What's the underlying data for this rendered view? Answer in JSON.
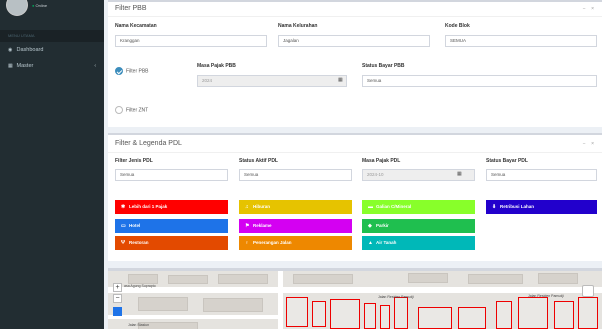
{
  "sidebar": {
    "user_status": "Online",
    "menu_header": "MENU UTAMA",
    "items": [
      {
        "label": "Dashboard",
        "icon": "dashboard-icon"
      },
      {
        "label": "Master",
        "icon": "th-icon"
      }
    ]
  },
  "filter_pbb": {
    "title": "Filter PBB",
    "tools": "− ×",
    "kecamatan_label": "Nama Kecamatan",
    "kecamatan_value": "Kranggan",
    "kelurahan_label": "Nama Kelurahan",
    "kelurahan_value": "Jagalan",
    "blok_label": "Kode Blok",
    "blok_value": "SEMUA",
    "radio_pbb_label": "Filter PBB",
    "masa_pajak_label": "Masa Pajak PBB",
    "masa_pajak_value": "2024",
    "status_bayar_label": "Status Bayar PBB",
    "status_bayar_value": "Semua",
    "radio_znt_label": "Filter ZNT"
  },
  "filter_pdl": {
    "title": "Filter & Legenda PDL",
    "tools": "− ×",
    "jenis_label": "Filter Jenis PDL",
    "jenis_value": "Semua",
    "status_aktif_label": "Status Aktif PDL",
    "status_aktif_value": "Semua",
    "masa_pajak_label": "Masa Pajak PDL",
    "masa_pajak_value": "2024-10",
    "status_bayar_label": "Status Bayar PDL",
    "status_bayar_value": "Semua"
  },
  "legend": [
    {
      "label": "Lebih dari 1 Pajak",
      "color": "#ff0000",
      "icon": "asterisk-icon"
    },
    {
      "label": "Hiburan",
      "color": "#e6c300",
      "icon": "music-icon"
    },
    {
      "label": "Galian C/Mineral",
      "color": "#88ff2a",
      "icon": "truck-icon"
    },
    {
      "label": "Retribusi Lahan",
      "color": "#2200cc",
      "icon": "pin-icon"
    },
    {
      "label": "Hotel",
      "color": "#1e73e8",
      "icon": "bed-icon"
    },
    {
      "label": "Reklame",
      "color": "#d400f2",
      "icon": "flag-icon"
    },
    {
      "label": "Parkir",
      "color": "#1fbf4f",
      "icon": "car-icon"
    },
    {
      "label": "Restoran",
      "color": "#e34a00",
      "icon": "utensils-icon"
    },
    {
      "label": "Penerangan Jalan",
      "color": "#ee8800",
      "icon": "bulb-icon"
    },
    {
      "label": "Air Tanah",
      "color": "#00b8b8",
      "icon": "water-icon"
    }
  ],
  "map": {
    "zoom_in": "+",
    "zoom_out": "−",
    "road_labels": [
      "asa Agung Suprapto",
      "Jalan Residen Pamudji",
      "Jalan Residen Pamudji",
      "Jalan Stasiun"
    ]
  }
}
